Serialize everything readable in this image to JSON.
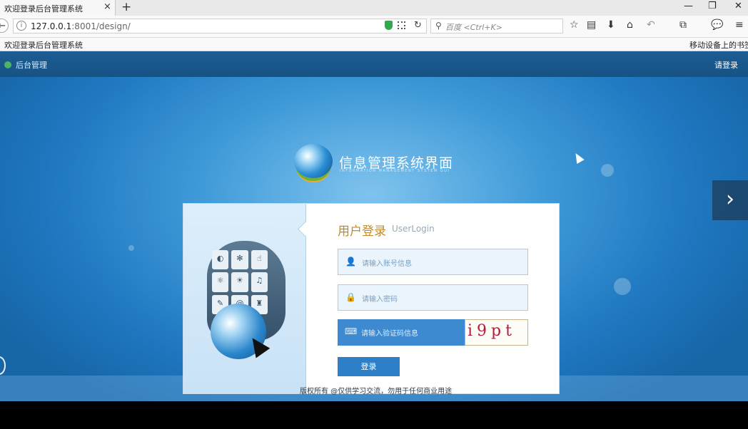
{
  "browser": {
    "tab_title": "欢迎登录后台管理系统",
    "tab_close": "×",
    "new_tab": "+",
    "url_host": "127.0.0.1",
    "url_rest": ":8001/design/",
    "search_placeholder": "百度 <Ctrl+K>",
    "bookmark_left": "欢迎登录后台管理系统",
    "bookmark_right": "移动设备上的书签",
    "window_controls": [
      "—",
      "❐",
      "✕"
    ]
  },
  "topbar": {
    "title": "后台管理",
    "login_link": "请登录"
  },
  "logo": {
    "title": "信息管理系统界面",
    "subtitle": "INFORMATION MANAGEMENT SYSTEM GUI"
  },
  "login": {
    "title": "用户登录",
    "title_en": "UserLogin",
    "account_placeholder": "请输入账号信息",
    "password_placeholder": "请输入密码",
    "captcha_placeholder": "请输入验证码信息",
    "captcha_text": "i9pt",
    "submit_label": "登录"
  },
  "footer": {
    "text": "版权所有 @仅供学习交流，勿用于任何商业用途"
  },
  "nav": {
    "next_arrow": "›"
  }
}
